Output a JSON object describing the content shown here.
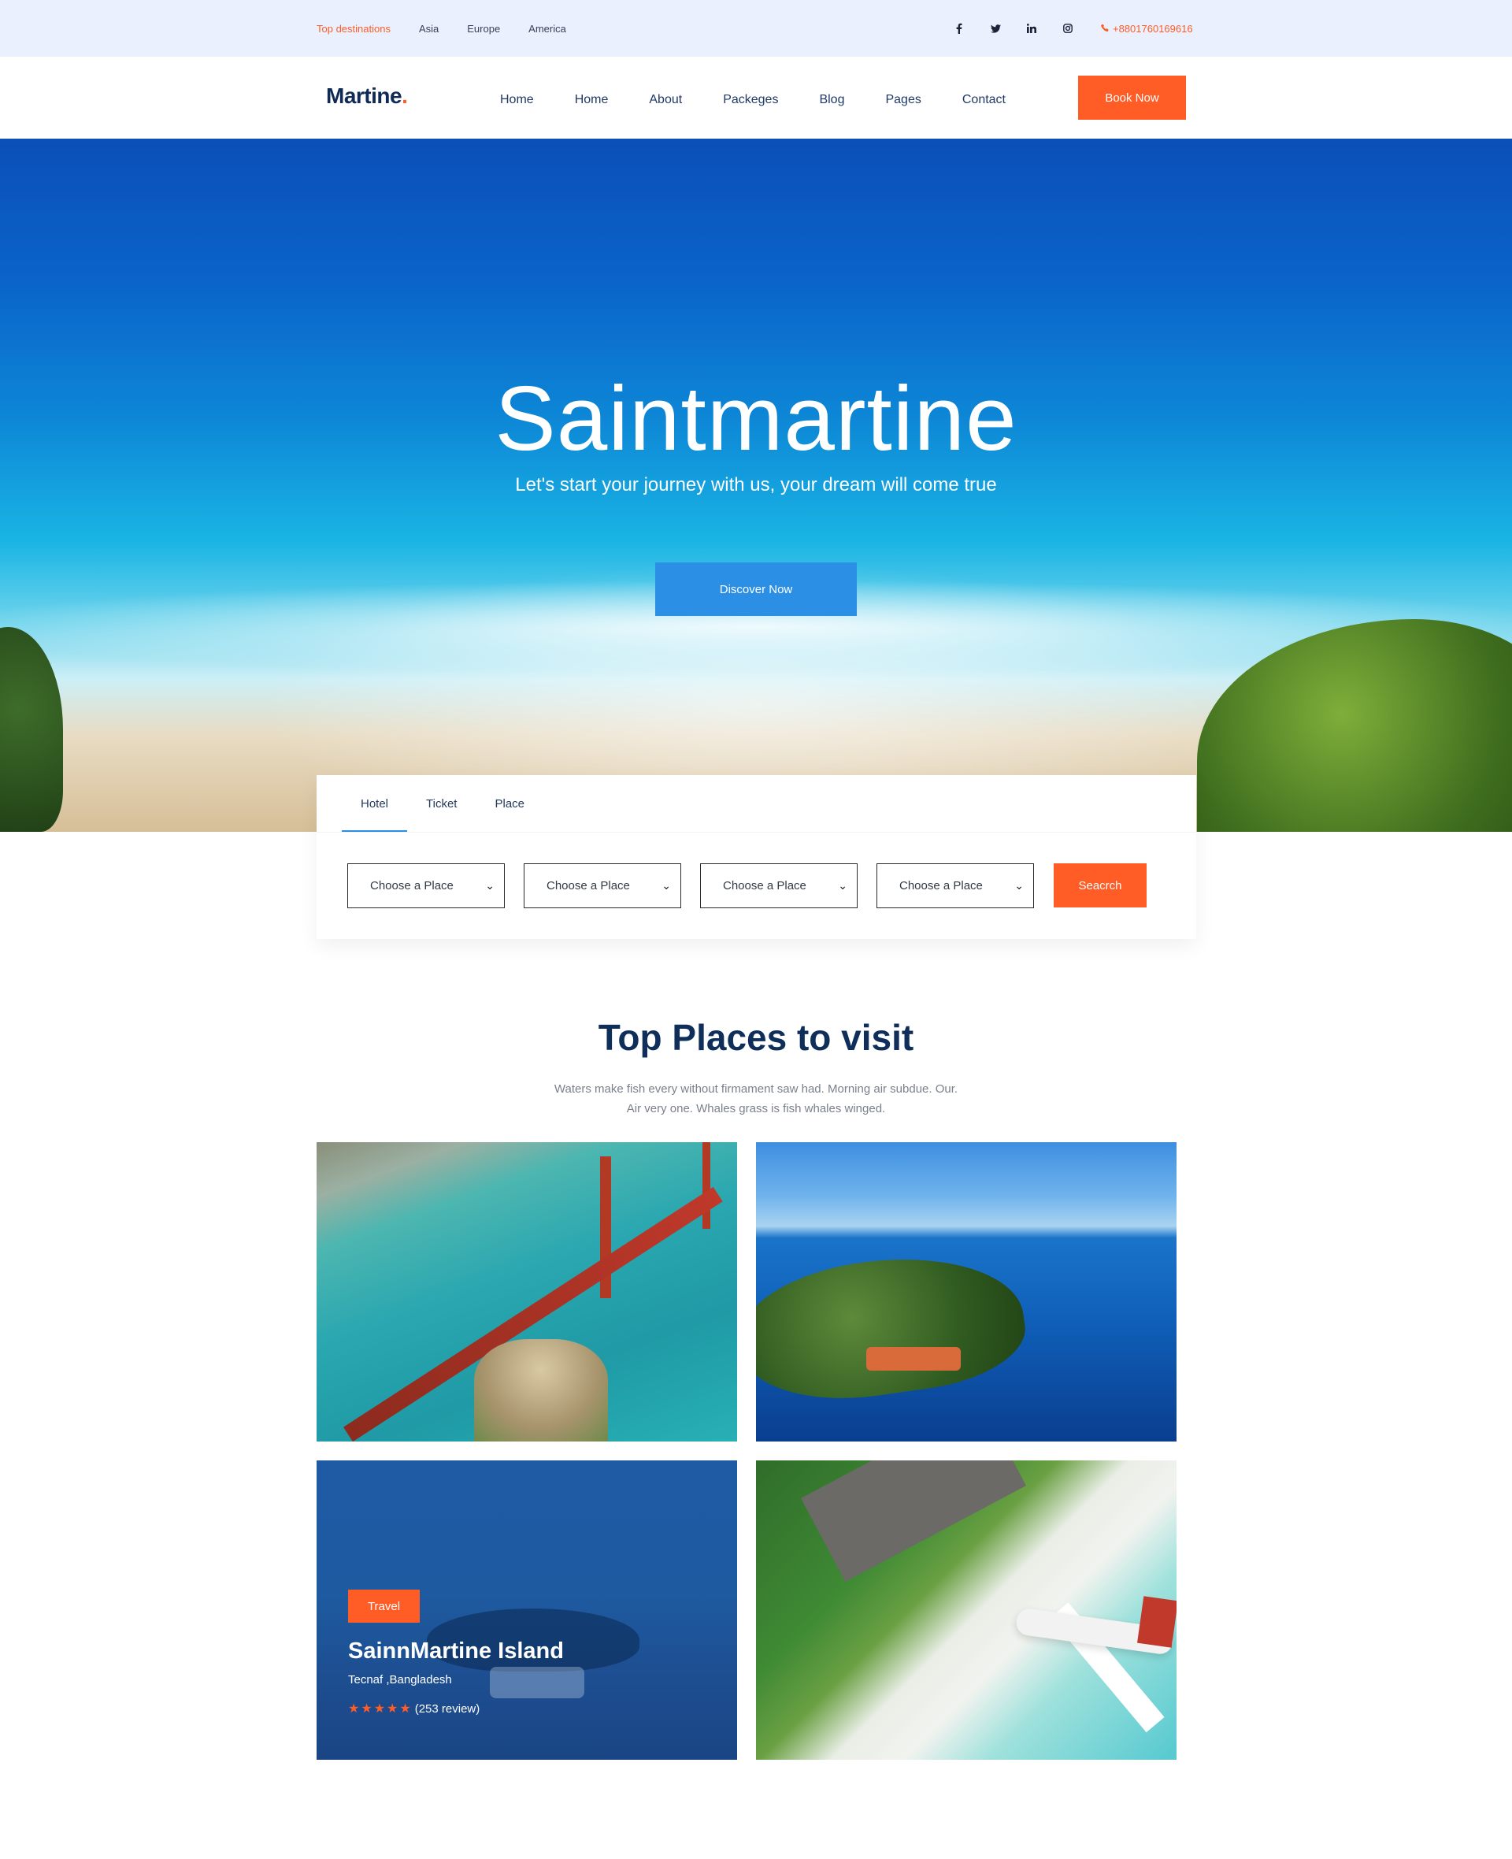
{
  "topbar": {
    "links": [
      "Top destinations",
      "Asia",
      "Europe",
      "America"
    ],
    "social": [
      "f",
      "t",
      "in",
      "ig"
    ],
    "phone": "+8801760169616",
    "colors": {
      "accent": "#ff5c26",
      "bg": "#eaf0fd"
    }
  },
  "nav": {
    "logo": "Martine",
    "logo_dot": ".",
    "menu": [
      "Home",
      "Home",
      "About",
      "Packeges",
      "Blog",
      "Pages",
      "Contact"
    ],
    "book_label": "Book Now"
  },
  "hero": {
    "title": "Saintmartine",
    "subtitle": "Let's start your journey with us, your dream will come true",
    "cta": "Discover Now"
  },
  "booking": {
    "tabs": [
      "Hotel",
      "Ticket",
      "Place"
    ],
    "active_tab": "Hotel",
    "selects": [
      "Choose a Place",
      "Choose a Place",
      "Choose a Place",
      "Choose a Place"
    ],
    "search_label": "Seacrch"
  },
  "places": {
    "title": "Top Places to visit",
    "description_line1": "Waters make fish every without firmament saw had. Morning air subdue. Our.",
    "description_line2": "Air very one. Whales grass is fish whales winged.",
    "featured": {
      "tag": "Travel",
      "name": "SainnMartine Island",
      "location": "Tecnaf ,Bangladesh",
      "stars": 5,
      "reviews": "(253 review)"
    }
  },
  "colors": {
    "primary": "#2c8fe6",
    "accent": "#ff5c26",
    "heading": "#0f2f5a"
  }
}
